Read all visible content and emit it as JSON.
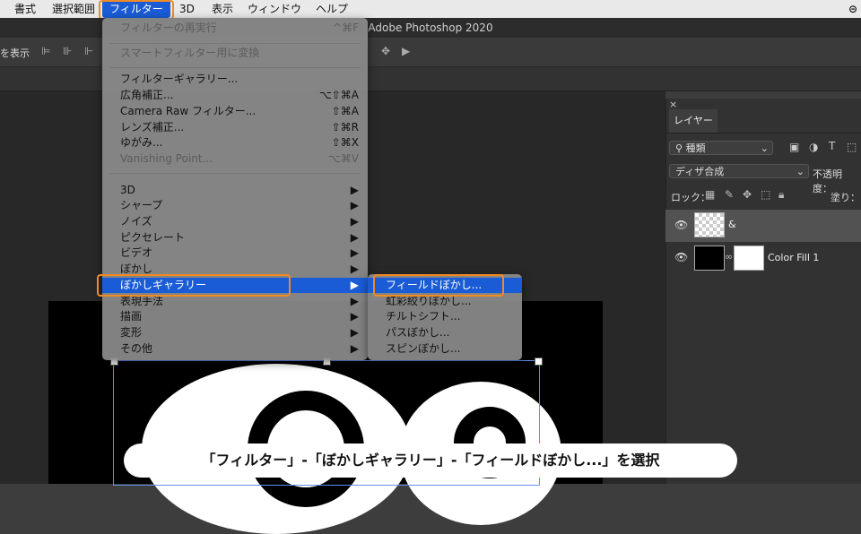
{
  "menubar": {
    "items": [
      "書式",
      "選択範囲",
      "フィルター",
      "3D",
      "表示",
      "ウィンドウ",
      "ヘルプ"
    ]
  },
  "app_title": "Adobe Photoshop 2020",
  "options_bar": {
    "show_label": "を表示"
  },
  "filter_menu": {
    "items": [
      {
        "label": "フィルターの再実行",
        "shortcut": "^⌘F",
        "disabled": true
      },
      {
        "label": "スマートフィルター用に変換",
        "shortcut": "",
        "disabled": true
      },
      {
        "label": "フィルターギャラリー...",
        "shortcut": ""
      },
      {
        "label": "広角補正...",
        "shortcut": "⌥⇧⌘A"
      },
      {
        "label": "Camera Raw フィルター...",
        "shortcut": "⇧⌘A"
      },
      {
        "label": "レンズ補正...",
        "shortcut": "⇧⌘R"
      },
      {
        "label": "ゆがみ...",
        "shortcut": "⇧⌘X"
      },
      {
        "label": "Vanishing Point...",
        "shortcut": "⌥⌘V",
        "disabled": true
      },
      {
        "label": "3D",
        "shortcut": "▶"
      },
      {
        "label": "シャープ",
        "shortcut": "▶"
      },
      {
        "label": "ノイズ",
        "shortcut": "▶"
      },
      {
        "label": "ピクセレート",
        "shortcut": "▶"
      },
      {
        "label": "ビデオ",
        "shortcut": "▶"
      },
      {
        "label": "ぼかし",
        "shortcut": "▶"
      },
      {
        "label": "ぼかしギャラリー",
        "shortcut": "▶",
        "selected": true
      },
      {
        "label": "表現手法",
        "shortcut": "▶"
      },
      {
        "label": "描画",
        "shortcut": "▶"
      },
      {
        "label": "変形",
        "shortcut": "▶"
      },
      {
        "label": "その他",
        "shortcut": "▶"
      }
    ]
  },
  "blur_gallery_submenu": {
    "items": [
      {
        "label": "フィールドぼかし...",
        "selected": true
      },
      {
        "label": "虹彩絞りぼかし..."
      },
      {
        "label": "チルトシフト..."
      },
      {
        "label": "パスぼかし..."
      },
      {
        "label": "スピンぼかし..."
      }
    ]
  },
  "layers_panel": {
    "close": "×",
    "tab": "レイヤー",
    "filter_kind": "種類",
    "blend_mode": "ディザ合成",
    "opacity_label": "不透明度：",
    "lock_label": "ロック：",
    "fill_label": "塗り：",
    "layers": [
      {
        "name": "&"
      },
      {
        "name": "Color Fill 1"
      }
    ]
  },
  "caption": "「フィルター」-「ぼかしギャラリー」-「フィールドぼかし...」を選択",
  "colors": {
    "accent": "#1a5cd6",
    "highlight": "#f08a24"
  }
}
